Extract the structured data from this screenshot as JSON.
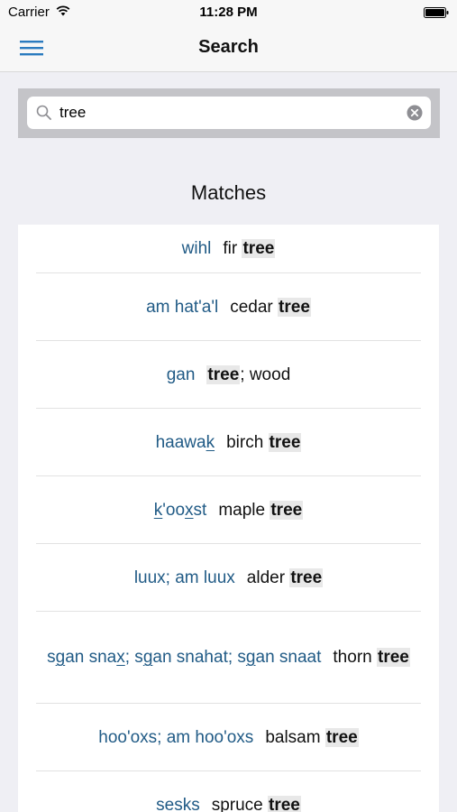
{
  "status_bar": {
    "carrier": "Carrier",
    "time": "11:28 PM"
  },
  "nav": {
    "title": "Search",
    "menu_icon": "hamburger-menu-icon"
  },
  "search": {
    "value": "tree",
    "placeholder": "",
    "search_icon": "magnifier-icon",
    "clear_icon": "clear-circle-icon"
  },
  "matches_heading": "Matches",
  "colors": {
    "link_blue": "#215b86",
    "highlight_bg": "#e8e8e8",
    "background": "#efeff4"
  },
  "results": [
    {
      "gitxsan": [
        {
          "t": "wihl"
        }
      ],
      "english": [
        {
          "t": "fir "
        },
        {
          "t": "tree",
          "hl": true
        }
      ]
    },
    {
      "gitxsan": [
        {
          "t": "am hat'a'l"
        }
      ],
      "english": [
        {
          "t": "cedar "
        },
        {
          "t": "tree",
          "hl": true
        }
      ]
    },
    {
      "gitxsan": [
        {
          "t": "gan"
        }
      ],
      "english": [
        {
          "t": "tree",
          "hl": true
        },
        {
          "t": "; wood"
        }
      ]
    },
    {
      "gitxsan": [
        {
          "t": "haawa"
        },
        {
          "t": "k",
          "u": true
        }
      ],
      "english": [
        {
          "t": "birch "
        },
        {
          "t": "tree",
          "hl": true
        }
      ]
    },
    {
      "gitxsan": [
        {
          "t": "k",
          "u": true
        },
        {
          "t": "'oo"
        },
        {
          "t": "x",
          "u": true
        },
        {
          "t": "st"
        }
      ],
      "english": [
        {
          "t": "maple "
        },
        {
          "t": "tree",
          "hl": true
        }
      ]
    },
    {
      "gitxsan": [
        {
          "t": "luux; am luux"
        }
      ],
      "english": [
        {
          "t": "alder "
        },
        {
          "t": "tree",
          "hl": true
        }
      ]
    },
    {
      "gitxsan": [
        {
          "t": "s"
        },
        {
          "t": "g",
          "u": true
        },
        {
          "t": "an sna"
        },
        {
          "t": "x",
          "u": true
        },
        {
          "t": "; s"
        },
        {
          "t": "g",
          "u": true
        },
        {
          "t": "an snahat; s"
        },
        {
          "t": "g",
          "u": true
        },
        {
          "t": "an snaat"
        }
      ],
      "english": [
        {
          "t": "thorn "
        },
        {
          "t": "tree",
          "hl": true
        }
      ]
    },
    {
      "gitxsan": [
        {
          "t": "hoo'oxs; am hoo'oxs"
        }
      ],
      "english": [
        {
          "t": "balsam "
        },
        {
          "t": "tree",
          "hl": true
        }
      ]
    },
    {
      "gitxsan": [
        {
          "t": "sesks"
        }
      ],
      "english": [
        {
          "t": "spruce "
        },
        {
          "t": "tree",
          "hl": true
        }
      ]
    }
  ]
}
